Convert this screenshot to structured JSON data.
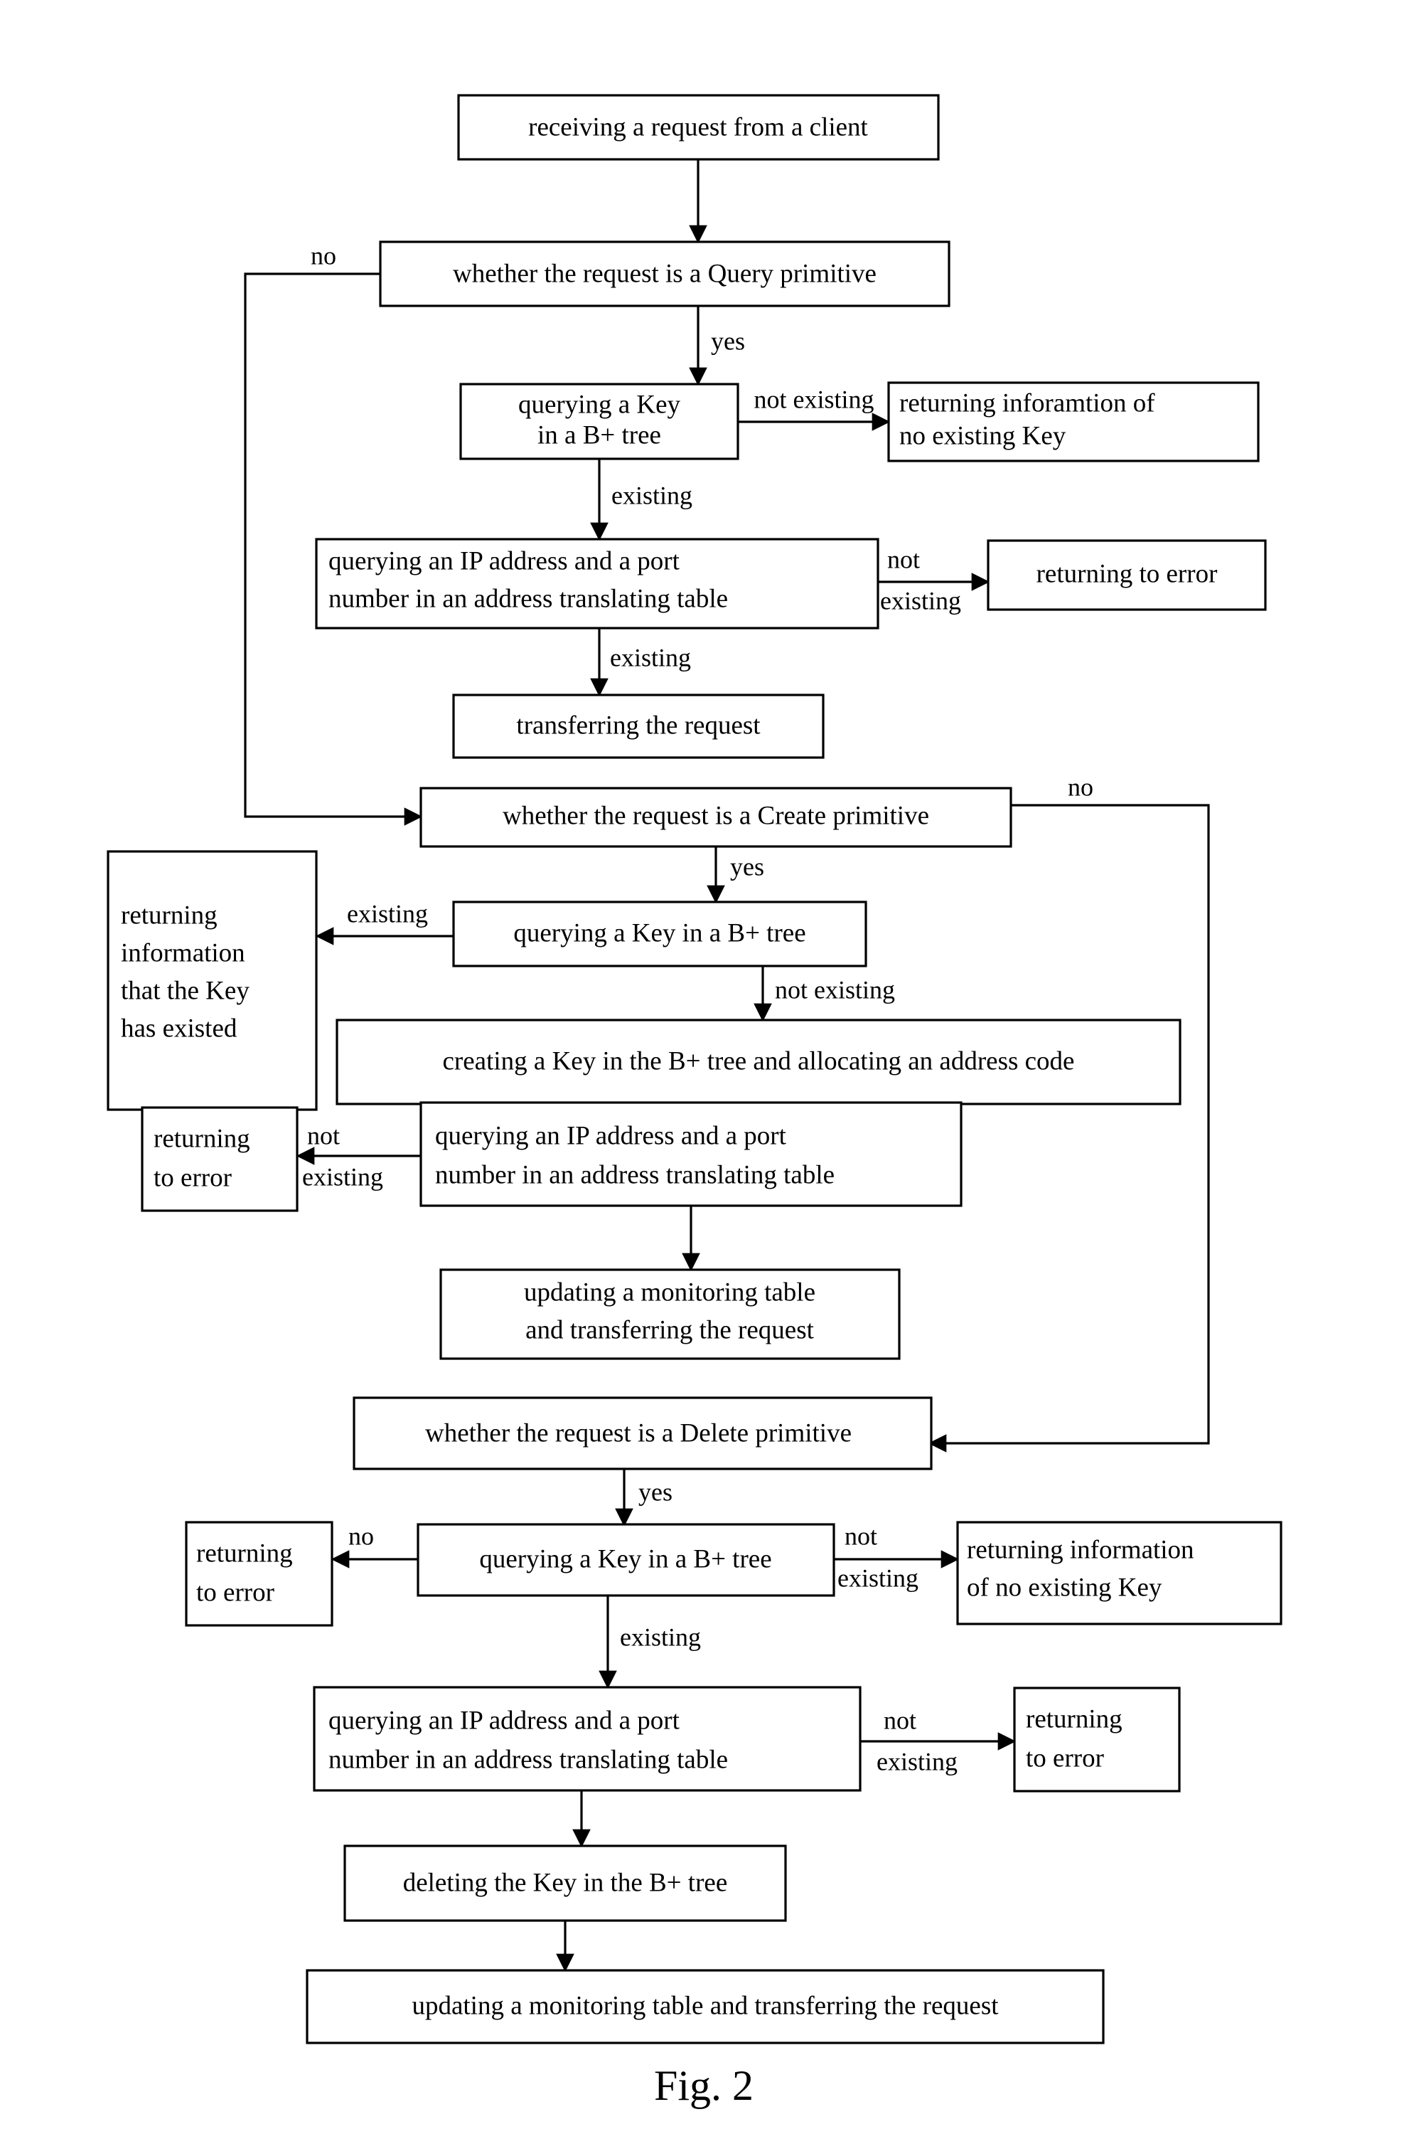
{
  "figure": {
    "caption": "Fig. 2",
    "type": "flowchart"
  },
  "nodes": {
    "receive_request": "receiving a request from a client",
    "is_query": "whether the request is a Query primitive",
    "query_key_btree_1_l1": "querying a Key",
    "query_key_btree_1_l2": "in a B+ tree",
    "return_no_key_info_1_l1": "returning inforamtion of",
    "return_no_key_info_1_l2": "no existing Key",
    "query_ip_port_1_l1": "querying an IP address and a port",
    "query_ip_port_1_l2": "number in an address translating table",
    "return_error_1": "returning to error",
    "transfer_request": "transferring the request",
    "is_create": "whether the request is a Create primitive",
    "key_existed_l1": "returning",
    "key_existed_l2": "information",
    "key_existed_l3": "that the Key",
    "key_existed_l4": "has existed",
    "query_key_btree_2": "querying a Key in a B+ tree",
    "create_key_alloc": "creating a Key in the B+ tree and allocating an address code",
    "return_error_2_l1": "returning",
    "return_error_2_l2": "to error",
    "query_ip_port_2_l1": "querying an IP address and a port",
    "query_ip_port_2_l2": "number in an address translating table",
    "update_transfer_2_l1": "updating a monitoring table",
    "update_transfer_2_l2": "and transferring the request",
    "is_delete": "whether the request is a Delete primitive",
    "return_error_3_l1": "returning",
    "return_error_3_l2": "to error",
    "query_key_btree_3": "querying a Key in a B+ tree",
    "return_no_key_info_2_l1": "returning information",
    "return_no_key_info_2_l2": "of no existing Key",
    "query_ip_port_3_l1": "querying an IP address and a port",
    "query_ip_port_3_l2": "number in an address translating table",
    "return_error_4_l1": "returning",
    "return_error_4_l2": "to error",
    "delete_key_btree": "deleting the Key in the B+ tree",
    "update_transfer_3": "updating a monitoring table and transferring the request"
  },
  "edge_labels": {
    "query_no": "no",
    "query_yes": "yes",
    "key1_not_existing": "not existing",
    "key1_existing": "existing",
    "ip1_not": "not",
    "ip1_existing": "existing",
    "ip1_existing_down": "existing",
    "create_no": "no",
    "create_yes": "yes",
    "key2_existing": "existing",
    "key2_not_existing": "not existing",
    "ip2_not": "not",
    "ip2_existing": "existing",
    "delete_yes": "yes",
    "key3_no": "no",
    "key3_not": "not",
    "key3_existing_right": "existing",
    "key3_existing_down": "existing",
    "ip3_not": "not",
    "ip3_existing": "existing"
  },
  "colors": {
    "stroke": "#000000",
    "fill": "#ffffff",
    "text": "#000000"
  }
}
